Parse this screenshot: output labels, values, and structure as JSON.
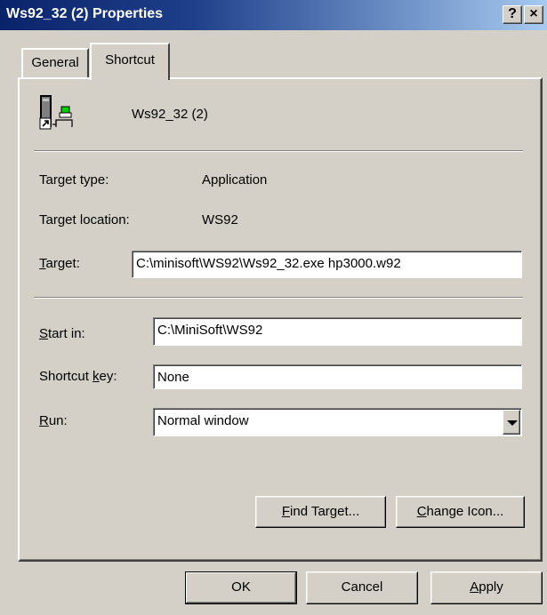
{
  "window": {
    "title": "Ws92_32 (2) Properties",
    "help_button": "?",
    "close_button": "×"
  },
  "tabs": [
    {
      "label": "General",
      "active": false
    },
    {
      "label": "Shortcut",
      "active": true
    }
  ],
  "shortcut": {
    "name": "Ws92_32 (2)",
    "target_type_label": "Target type:",
    "target_type_value": "Application",
    "target_location_label": "Target location:",
    "target_location_value": "WS92",
    "target_label_pre": "",
    "target_label_ul": "T",
    "target_label_post": "arget:",
    "target_value": "C:\\minisoft\\WS92\\Ws92_32.exe hp3000.w92",
    "start_in_label_ul": "S",
    "start_in_label_post": "tart in:",
    "start_in_value": "C:\\MiniSoft\\WS92",
    "shortcut_key_label_pre": "Shortcut ",
    "shortcut_key_label_ul": "k",
    "shortcut_key_label_post": "ey:",
    "shortcut_key_value": "None",
    "run_label_ul": "R",
    "run_label_post": "un:",
    "run_value": "Normal window",
    "find_target_ul": "F",
    "find_target_post": "ind Target...",
    "change_icon_ul": "C",
    "change_icon_post": "hange Icon..."
  },
  "dialog_buttons": {
    "ok": "OK",
    "cancel": "Cancel",
    "apply_ul": "A",
    "apply_post": "pply"
  },
  "colors": {
    "titlebar_start": "#0a246a",
    "titlebar_end": "#a6caf0",
    "face": "#d4d0c8"
  }
}
